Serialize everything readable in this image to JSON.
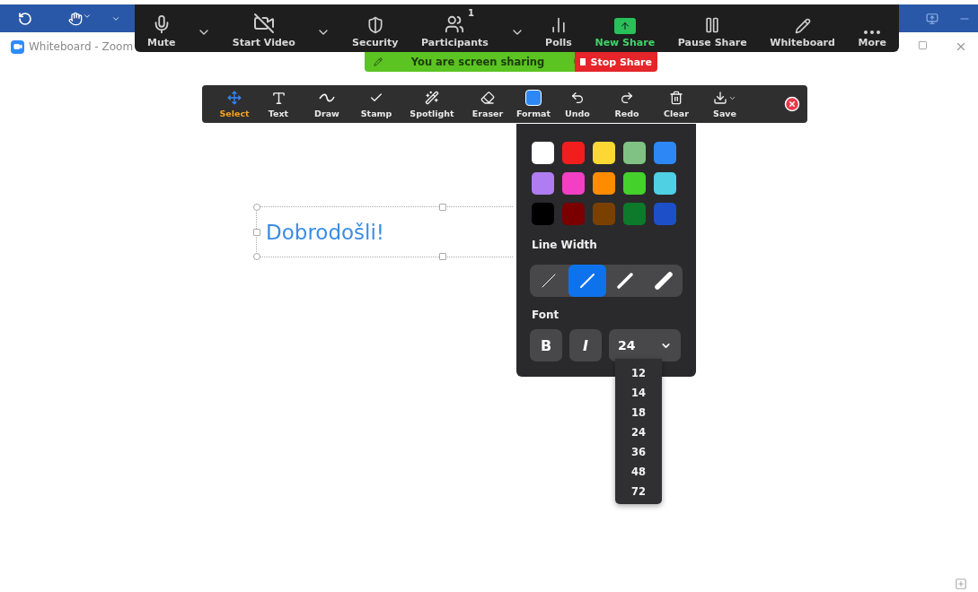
{
  "window": {
    "title": "Whiteboard - Zoom"
  },
  "meeting_controls": [
    {
      "kind": "button",
      "label": "Mute",
      "active": false
    },
    {
      "kind": "menu"
    },
    {
      "kind": "button",
      "label": "Start Video",
      "active": false
    },
    {
      "kind": "menu"
    },
    {
      "kind": "button",
      "label": "Security",
      "active": false
    },
    {
      "kind": "button",
      "label": "Participants",
      "badge": "1",
      "active": false
    },
    {
      "kind": "menu"
    },
    {
      "kind": "button",
      "label": "Polls",
      "active": false
    },
    {
      "kind": "button",
      "label": "New Share",
      "active": true
    },
    {
      "kind": "button",
      "label": "Pause Share",
      "active": false
    },
    {
      "kind": "button",
      "label": "Whiteboard",
      "active": false
    },
    {
      "kind": "button",
      "label": "More",
      "active": false
    }
  ],
  "sharing_banner": {
    "text": "You are screen sharing",
    "stop_label": "Stop Share"
  },
  "whiteboard_tools": [
    {
      "label": "Select",
      "selected": true
    },
    {
      "label": "Text",
      "selected": false
    },
    {
      "label": "Draw",
      "selected": false
    },
    {
      "label": "Stamp",
      "selected": false
    },
    {
      "label": "Spotlight",
      "selected": false
    },
    {
      "label": "Eraser",
      "selected": false
    },
    {
      "label": "Format",
      "selected": false
    },
    {
      "label": "Undo",
      "selected": false
    },
    {
      "label": "Redo",
      "selected": false
    },
    {
      "label": "Clear",
      "selected": false
    },
    {
      "label": "Save",
      "selected": false
    }
  ],
  "format_panel": {
    "colors": [
      {
        "color": "#ffffff"
      },
      {
        "color": "#f21d1d"
      },
      {
        "color": "#fdd835"
      },
      {
        "color": "#7fc283"
      },
      {
        "color": "#2d88f5"
      },
      {
        "color": "#b07cf2"
      },
      {
        "color": "#f23fc3"
      },
      {
        "color": "#ff8c00"
      },
      {
        "color": "#44d12c"
      },
      {
        "color": "#4fd0e3"
      },
      {
        "color": "#000000"
      },
      {
        "color": "#7a0000"
      },
      {
        "color": "#7a4000"
      },
      {
        "color": "#0c7a2a"
      },
      {
        "color": "#1d4fc8"
      }
    ],
    "line_width_label": "Line Width",
    "line_widths": [
      {
        "selected": false
      },
      {
        "selected": true
      },
      {
        "selected": false
      },
      {
        "selected": false
      }
    ],
    "font_label": "Font",
    "bold": {
      "label": "B",
      "on": false
    },
    "italic": {
      "label": "I",
      "on": false
    },
    "font_size": {
      "value": "24",
      "expanded": true
    },
    "size_options": [
      "12",
      "14",
      "18",
      "24",
      "36",
      "48",
      "72"
    ]
  },
  "canvas_text": "Dobrodošli!"
}
